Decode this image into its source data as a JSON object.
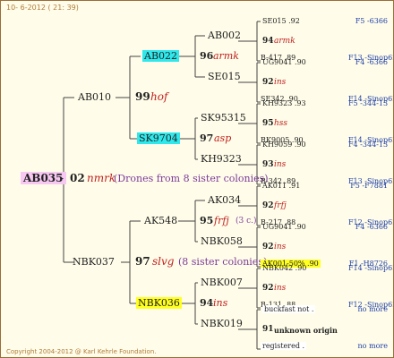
{
  "header": {
    "date": "10- 6-2012 ( 21: 39)"
  },
  "footer": {
    "copyright": "Copyright 2004-2012 @ Karl Kehrle Foundation."
  },
  "tree": {
    "root": {
      "id": "AB035",
      "year": "02",
      "breed": "nmrk",
      "note": "(Drones from 8 sister colonies)"
    },
    "sire": {
      "id": "AB010"
    },
    "dam": {
      "id": "NBK037",
      "year": "97",
      "breed": "slvg",
      "note": "(8 sister colonies)"
    },
    "ab010_sire": {
      "id": "AB022"
    },
    "ab010_mid": {
      "year": "99",
      "breed": "hof"
    },
    "ab010_dam": {
      "id": "SK9704"
    },
    "nbk037_sire": {
      "id": "AK548"
    },
    "nbk037_dam": {
      "id": "NBK036"
    },
    "ab022_mid": {
      "year": "96",
      "breed": "armk"
    },
    "ab022_sire": {
      "id": "AB002"
    },
    "ab022_dam": {
      "id": "SE015"
    },
    "sk9704_mid": {
      "year": "97",
      "breed": "asp"
    },
    "sk9704_sire": {
      "id": "SK95315"
    },
    "sk9704_dam": {
      "id": "KH9323"
    },
    "ak548_mid": {
      "year": "95",
      "breed": "frfj",
      "note": "(3 c.)"
    },
    "ak548_sire": {
      "id": "AK034"
    },
    "ak548_dam": {
      "id": "NBK058"
    },
    "nbk036_mid": {
      "year": "94",
      "breed": "ins"
    },
    "nbk036_sire": {
      "id": "NBK007"
    },
    "nbk036_dam": {
      "id": "NBK019"
    }
  },
  "right_groups": [
    {
      "top": "SE015 .92",
      "top_code": "F5 -6366",
      "mid_year": "94",
      "mid_breed": "armk",
      "bottom": "B-417 .89",
      "bottom_code": "F13 -Sinop62R"
    },
    {
      "top": "UG9041 .90",
      "top_code": "F4 -6366",
      "mid_year": "92",
      "mid_breed": "ins",
      "bottom": "SE342 .90",
      "bottom_code": "F14 -Sinop62R"
    },
    {
      "top": "KH9323 .93",
      "top_code": "F5 -344-13",
      "mid_year": "95",
      "mid_breed": "hss",
      "bottom": "RK9005 .90",
      "bottom_code": "F14 -Sinop62R"
    },
    {
      "top": "KH9059 .90",
      "top_code": "F4 -344-13",
      "mid_year": "93",
      "mid_breed": "ins",
      "bottom": "B-342 .89",
      "bottom_code": "F13 -Sinop62R"
    },
    {
      "top": "AK011 .91",
      "top_code": "F5 -F7881",
      "mid_year": "92",
      "mid_breed": "frfj",
      "bottom": "B-217 .88",
      "bottom_code": "F12 -Sinop62R"
    },
    {
      "top": "UG9041 .90",
      "top_code": "F4 -6366",
      "mid_year": "92",
      "mid_breed": "ins",
      "bottom": "AK001-50% .90",
      "bottom_code": "F1 -H8726"
    },
    {
      "top": "NBK042 .90",
      "top_code": "F14 -Sinop62R",
      "mid_year": "92",
      "mid_breed": "ins",
      "bottom": "B-131 .88",
      "bottom_code": "F12 -Sinop62R"
    },
    {
      "top": "buckfast not .",
      "top_code": "no more",
      "mid_year": "91",
      "mid_breed": "unknown origin",
      "bottom": "registered .",
      "bottom_code": "no more"
    }
  ]
}
